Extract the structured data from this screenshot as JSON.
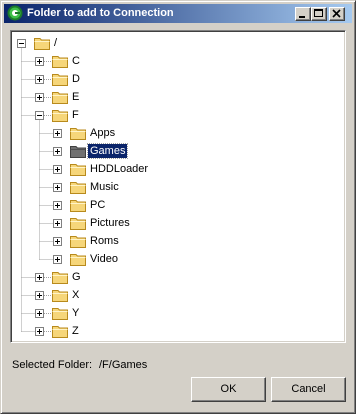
{
  "window": {
    "title": "Folder to add to Connection",
    "controls": [
      "minimize",
      "maximize",
      "close"
    ]
  },
  "tree": {
    "root": {
      "label": "/",
      "expanded": true
    },
    "nodes": [
      {
        "label": "C",
        "expanded": false
      },
      {
        "label": "D",
        "expanded": false
      },
      {
        "label": "E",
        "expanded": false
      },
      {
        "label": "F",
        "expanded": true,
        "children": [
          {
            "label": "Apps"
          },
          {
            "label": "Games",
            "selected": true
          },
          {
            "label": "HDDLoader"
          },
          {
            "label": "Music"
          },
          {
            "label": "PC"
          },
          {
            "label": "Pictures"
          },
          {
            "label": "Roms"
          },
          {
            "label": "Video"
          }
        ]
      },
      {
        "label": "G",
        "expanded": false
      },
      {
        "label": "X",
        "expanded": false
      },
      {
        "label": "Y",
        "expanded": false
      },
      {
        "label": "Z",
        "expanded": false
      }
    ]
  },
  "footer": {
    "selected_caption": "Selected Folder:",
    "selected_path": "/F/Games",
    "ok_label": "OK",
    "cancel_label": "Cancel"
  },
  "colors": {
    "title_gradient_start": "#0a246a",
    "title_gradient_end": "#a6caf0",
    "selection": "#0a246a",
    "folder_yellow": "#f6d67a",
    "folder_selected": "#707070"
  },
  "icons": {
    "app": "green-circle-app-icon",
    "folder": "folder-icon",
    "expand": "plus-box-icon",
    "collapse": "minus-box-icon"
  }
}
